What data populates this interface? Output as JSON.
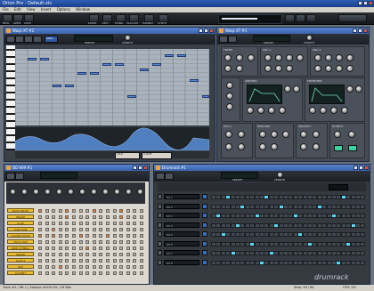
{
  "app": {
    "title": "Orion Pro - Default.xls",
    "menu": [
      "File",
      "Edit",
      "View",
      "Insert",
      "Options",
      "Window"
    ],
    "toolbar": [
      "NEW",
      "OPEN",
      "SAVE",
      "MIXER",
      "EDIT",
      "PIANO",
      "PLAYLIST",
      "SAMPLE",
      "SYNTH"
    ]
  },
  "windows": {
    "wasp_top": {
      "title": "Wasp XT #2",
      "preset_label": "PRESET",
      "knob_label": "LENGTH",
      "grid_button": "GRID",
      "quantize_value": "1/16",
      "quantize_label": "Cutoff"
    },
    "wasp_synth": {
      "title": "Wasp XT #1",
      "preset_label": "PRESET",
      "knob_label": "LENGTH",
      "sections": [
        "FILTER",
        "OSC 1",
        "OSC 2",
        "AMP ENV",
        "FILTER ENV",
        "LFO 2",
        "MOD ENV",
        "VELOCITY",
        "OUTPUT"
      ]
    },
    "drum": {
      "title": "DD 909 #1",
      "channels": [
        "BASS DRUM",
        "SNARE",
        "CLAP",
        "LOW TOM",
        "CLOSED HIHAT",
        "HIGH TOM",
        "RIDE CYMBAL",
        "CRASH",
        "CLAP 2",
        "RIM",
        "ACCENT"
      ]
    },
    "drumrack": {
      "title": "Drumrack #1",
      "preset_label": "PRESET",
      "knob_label": "LENGTH",
      "tracks": [
        "Kit 1",
        "Kit 2",
        "Kit 3",
        "Kit 4",
        "Kit 5",
        "Kit 6",
        "Kit 7",
        "Kit 8"
      ],
      "brand": "drumrack"
    }
  },
  "status": {
    "left": "Track #2 / Wt 1 | Sample 44100 Hz | 16 Bits",
    "step": "Step: 26 / 64",
    "cpu": "CPU: 5%"
  }
}
